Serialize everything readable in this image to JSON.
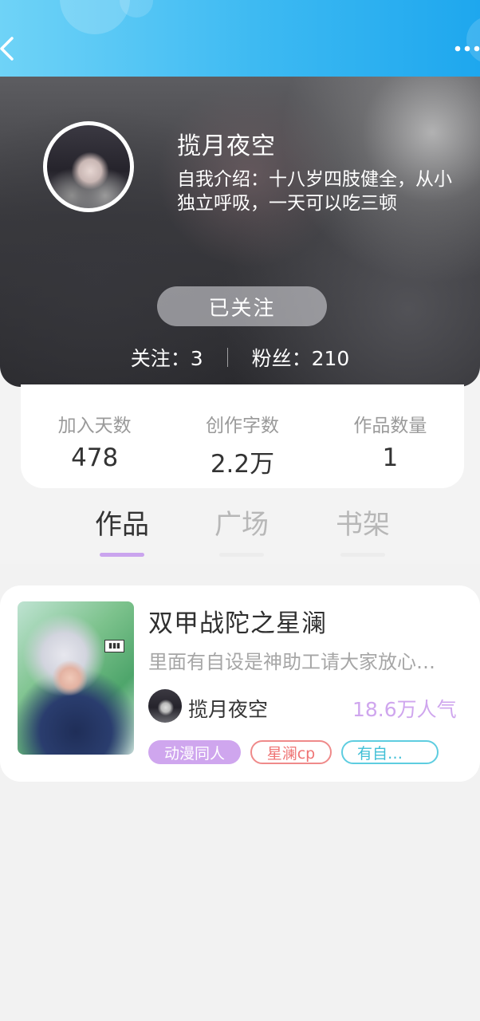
{
  "topbar": {
    "back_icon": "chevron-left-icon",
    "more_icon": "more-dots-icon",
    "gradient": [
      "#6fd3f7",
      "#1ea7ee"
    ]
  },
  "profile": {
    "name": "揽月夜空",
    "bio": "自我介绍：十八岁四肢健全，从小独立呼吸，一天可以吃三顿",
    "follow_button": "已关注",
    "following": "关注：3",
    "followers": "粉丝：210"
  },
  "stats": [
    {
      "label": "加入天数",
      "value": "478"
    },
    {
      "label": "创作字数",
      "value": "2.2万"
    },
    {
      "label": "作品数量",
      "value": "1"
    }
  ],
  "tabs": [
    {
      "label": "作品",
      "active": true
    },
    {
      "label": "广场",
      "active": false
    },
    {
      "label": "书架",
      "active": false
    }
  ],
  "works": [
    {
      "title": "双甲战陀之星澜",
      "description": "里面有自设是神助工请大家放心…",
      "author": "揽月夜空",
      "popularity": "18.6万人气",
      "tags": [
        "动漫同人",
        "星澜cp",
        "有自…"
      ],
      "accent_color": "#cfa6ee"
    }
  ]
}
